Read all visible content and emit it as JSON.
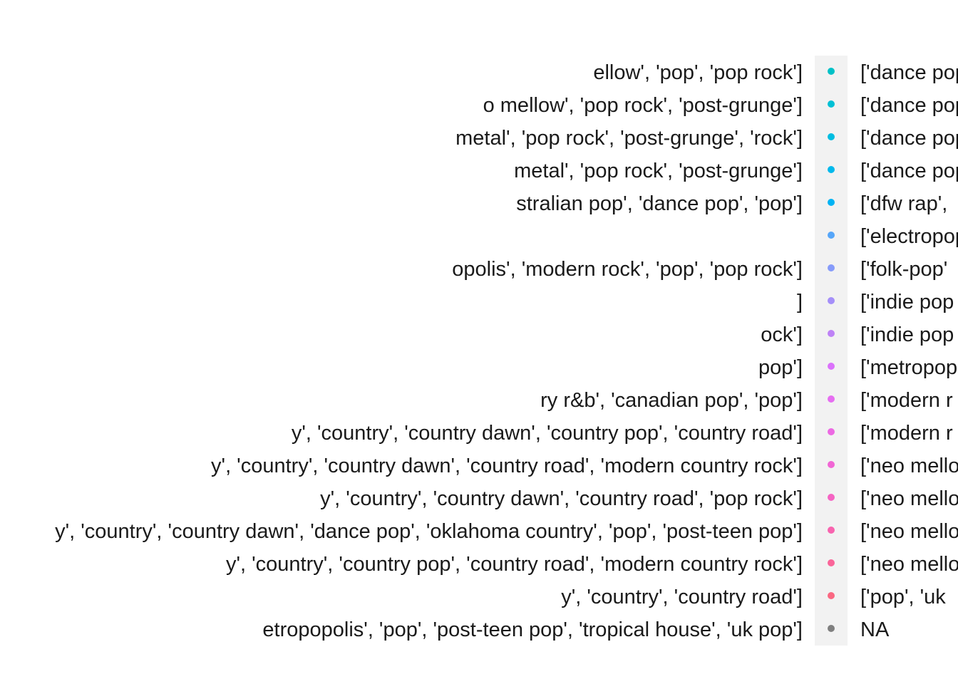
{
  "chart_data": {
    "type": "scatter",
    "legend_placement": "right",
    "legend_left_entries": [
      "ellow', 'pop', 'pop rock']",
      "o mellow', 'pop rock', 'post-grunge']",
      " metal', 'pop rock', 'post-grunge', 'rock']",
      " metal', 'pop rock', 'post-grunge']",
      "stralian pop', 'dance pop', 'pop']",
      "",
      "opolis', 'modern rock', 'pop', 'pop rock']",
      "]",
      "ock']",
      " pop']",
      "ry r&b', 'canadian pop', 'pop']",
      "y', 'country', 'country dawn', 'country pop', 'country road']",
      "y', 'country', 'country dawn', 'country road', 'modern country rock']",
      "y', 'country', 'country dawn', 'country road', 'pop rock']",
      "y', 'country', 'country dawn', 'dance pop', 'oklahoma country', 'pop', 'post-teen pop']",
      "y', 'country', 'country pop', 'country road', 'modern country rock']",
      "y', 'country', 'country road']",
      "etropopolis', 'pop', 'post-teen pop', 'tropical house', 'uk pop']"
    ],
    "legend_right_entries": [
      {
        "label": "['dance pop",
        "color": "#00C1C7"
      },
      {
        "label": "['dance pop",
        "color": "#00C0D5"
      },
      {
        "label": "['dance pop",
        "color": "#00BDE1"
      },
      {
        "label": "['dance pop",
        "color": "#00B9EC"
      },
      {
        "label": "['dfw rap',",
        "color": "#00B3F4"
      },
      {
        "label": "['electropop",
        "color": "#56A6F9"
      },
      {
        "label": "['folk-pop'",
        "color": "#869BFA"
      },
      {
        "label": "['indie pop",
        "color": "#A58FF9"
      },
      {
        "label": "['indie pop",
        "color": "#BE82F6"
      },
      {
        "label": "['metropop",
        "color": "#DB72FB"
      },
      {
        "label": "['modern r",
        "color": "#E66EF1"
      },
      {
        "label": "['modern r",
        "color": "#EC69E3"
      },
      {
        "label": "['neo mello",
        "color": "#F166D5"
      },
      {
        "label": "['neo mello",
        "color": "#F564C3"
      },
      {
        "label": "['neo mello",
        "color": "#F864AF"
      },
      {
        "label": "['neo mello",
        "color": "#FA6599"
      },
      {
        "label": "['pop', 'uk",
        "color": "#FA6882"
      },
      {
        "label": "NA",
        "color": "#7F7F7F"
      }
    ]
  }
}
